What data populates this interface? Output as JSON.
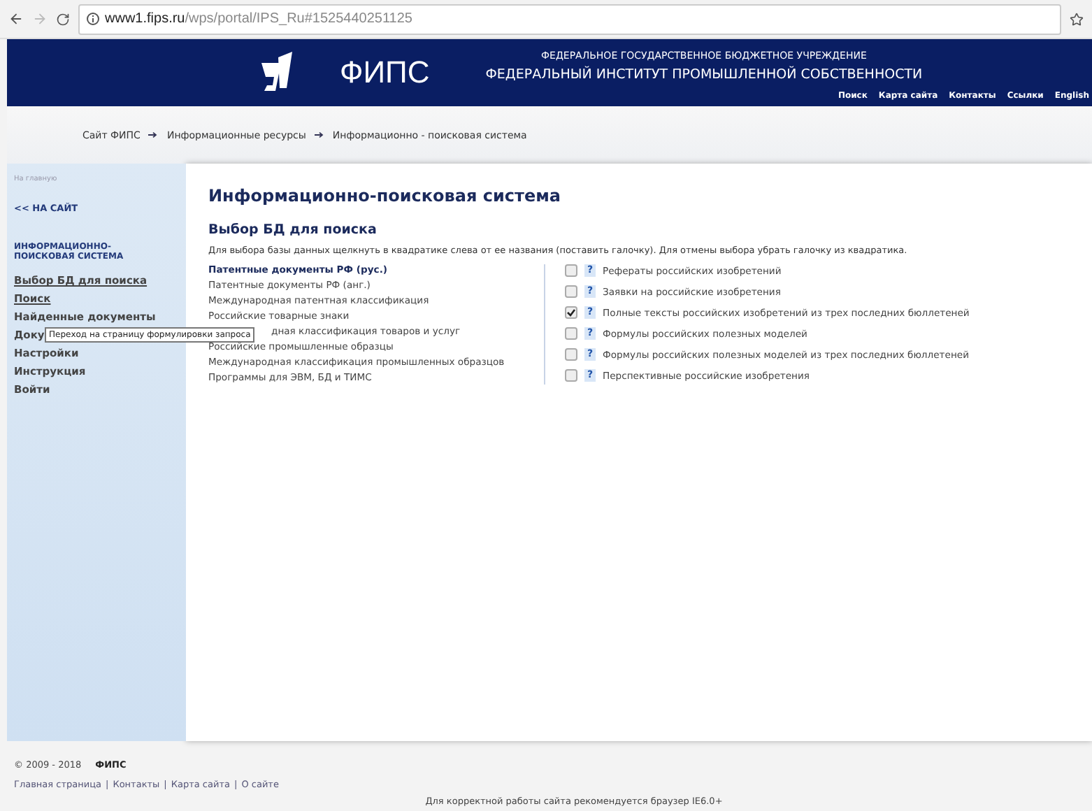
{
  "browser": {
    "url_host": "www1.fips.ru",
    "url_path": "/wps/portal/IPS_Ru#1525440251125"
  },
  "header": {
    "logo_text": "ФИПС",
    "org_line1": "ФЕДЕРАЛЬНОЕ ГОСУДАРСТВЕННОЕ БЮДЖЕТНОЕ УЧРЕЖДЕНИЕ",
    "org_line2": "ФЕДЕРАЛЬНЫЙ ИНСТИТУТ ПРОМЫШЛЕННОЙ СОБСТВЕННОСТИ",
    "links": [
      "Поиск",
      "Карта сайта",
      "Контакты",
      "Ссылки",
      "English"
    ]
  },
  "breadcrumb": [
    {
      "label": "Сайт ФИПС"
    },
    {
      "label": "Информационные ресурсы"
    },
    {
      "label": "Информационно - поисковая система"
    }
  ],
  "sidebar": {
    "home": "На главную",
    "back": "<< НА САЙТ",
    "section": "ИНФОРМАЦИОННО-ПОИСКОВАЯ СИСТЕМА",
    "items": [
      {
        "label": "Выбор БД для поиска",
        "underlined": true
      },
      {
        "label": "Поиск",
        "underlined": true
      },
      {
        "label": "Найденные документы",
        "underlined": false
      },
      {
        "label": "Доку",
        "underlined": false
      },
      {
        "label": "Настройки",
        "underlined": false
      },
      {
        "label": "Инструкция",
        "underlined": false
      },
      {
        "label": "Войти",
        "underlined": false
      }
    ]
  },
  "tooltip": "Переход на страницу формулировки запроса",
  "main": {
    "title": "Информационно-поисковая система",
    "subtitle": "Выбор БД для поиска",
    "description": "Для выбора базы данных щелкнуть в квадратике слева от ее названия (поставить галочку). Для отмены выбора убрать галочку из квадратика.",
    "categories": [
      {
        "label": "Патентные документы РФ (рус.)",
        "selected": true
      },
      {
        "label": "Патентные документы РФ (анг.)",
        "selected": false
      },
      {
        "label": "Международная патентная классификация",
        "selected": false
      },
      {
        "label": "Российские товарные знаки",
        "selected": false
      },
      {
        "label": "дная классификация товаров и услуг",
        "selected": false
      },
      {
        "label": "Российские промышленные образцы",
        "selected": false
      },
      {
        "label": "Международная классификация промышленных образцов",
        "selected": false
      },
      {
        "label": "Программы для ЭВМ, БД и ТИМС",
        "selected": false
      }
    ],
    "databases": [
      {
        "label": "Рефераты российских изобретений",
        "checked": false,
        "help": "?"
      },
      {
        "label": "Заявки на российские изобретения",
        "checked": false,
        "help": "?"
      },
      {
        "label": "Полные тексты российских изобретений из трех последних бюллетеней",
        "checked": true,
        "help": "?"
      },
      {
        "label": "Формулы российских полезных моделей",
        "checked": false,
        "help": "?"
      },
      {
        "label": "Формулы российских полезных моделей из трех последних бюллетеней",
        "checked": false,
        "help": "?"
      },
      {
        "label": "Перспективные российские изобретения",
        "checked": false,
        "help": "?"
      }
    ]
  },
  "footer": {
    "copyright": "© 2009 - 2018",
    "brand": "ФИПС",
    "links": [
      "Главная страница",
      "Контакты",
      "Карта сайта",
      "О сайте"
    ],
    "separator": "|",
    "note": "Для корректной работы сайта рекомендуется браузер IE6.0+"
  }
}
